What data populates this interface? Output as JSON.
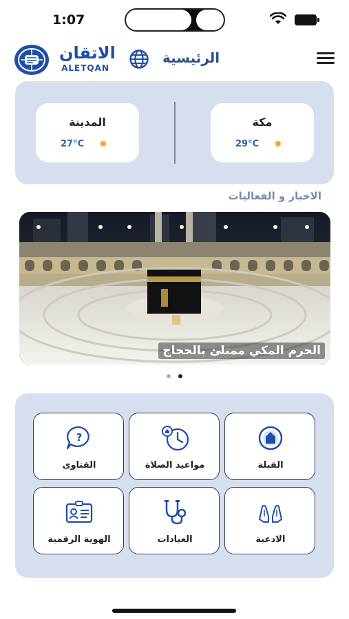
{
  "status": {
    "time": "1:07"
  },
  "header": {
    "title": "الرئيسية",
    "brand_ar": "الاتقان",
    "brand_en": "ALETQAN"
  },
  "weather": [
    {
      "city": "المدينة",
      "temp": "27°C"
    },
    {
      "city": "مكة",
      "temp": "29°C"
    }
  ],
  "news": {
    "title": "الاخبار و الفعاليات",
    "caption": "الحرم المكي ممتلئ بالحجاج"
  },
  "services": [
    {
      "label": "القبلة",
      "icon": "qibla-icon"
    },
    {
      "label": "مواعيد الصلاة",
      "icon": "prayer-clock-icon"
    },
    {
      "label": "الفتاوى",
      "icon": "fatwa-chat-icon"
    },
    {
      "label": "الادعية",
      "icon": "praying-hands-icon"
    },
    {
      "label": "العيادات",
      "icon": "stethoscope-icon"
    },
    {
      "label": "الهوية الرقمية",
      "icon": "id-card-icon"
    }
  ],
  "colors": {
    "panel": "#d7deed",
    "accent": "#2f63b8",
    "title": "#2b4f8c"
  }
}
